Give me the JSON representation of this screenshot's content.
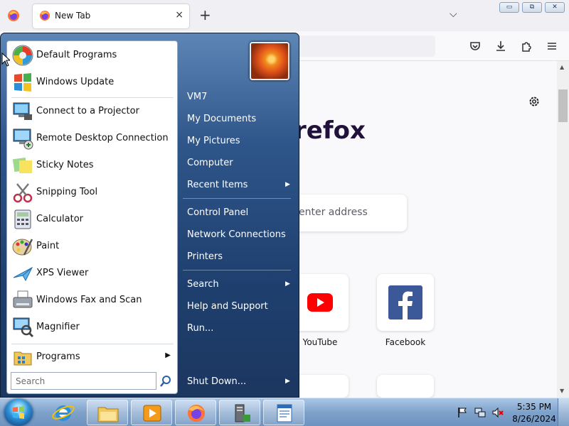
{
  "browser": {
    "tab_title": "New Tab",
    "tab_close": "×",
    "new_tab": "+",
    "list_tabs": "⌵",
    "window_buttons": [
      "▭",
      "⧉",
      "✕"
    ],
    "content": {
      "brand_text": "refox",
      "search_placeholder": "enter address",
      "shortcuts": [
        {
          "label": "YouTube"
        },
        {
          "label": "Facebook"
        }
      ]
    },
    "toolbar_icons": [
      "pocket-icon",
      "download-icon",
      "extensions-icon",
      "menu-icon"
    ],
    "accent": "#ff7139"
  },
  "start_menu": {
    "programs": [
      {
        "label": "Default Programs",
        "icon": "default-programs-icon"
      },
      {
        "label": "Windows Update",
        "icon": "windows-update-icon"
      },
      {
        "label": "Connect to a Projector",
        "icon": "projector-icon"
      },
      {
        "label": "Remote Desktop Connection",
        "icon": "remote-desktop-icon"
      },
      {
        "label": "Sticky Notes",
        "icon": "sticky-notes-icon"
      },
      {
        "label": "Snipping Tool",
        "icon": "snipping-tool-icon"
      },
      {
        "label": "Calculator",
        "icon": "calculator-icon"
      },
      {
        "label": "Paint",
        "icon": "paint-icon"
      },
      {
        "label": "XPS Viewer",
        "icon": "xps-viewer-icon"
      },
      {
        "label": "Windows Fax and Scan",
        "icon": "fax-scan-icon"
      },
      {
        "label": "Magnifier",
        "icon": "magnifier-icon"
      }
    ],
    "all_programs": "Programs",
    "search_placeholder": "Search",
    "right_links": [
      {
        "label": "VM7",
        "arrow": false
      },
      {
        "label": "My Documents",
        "arrow": false
      },
      {
        "label": "My Pictures",
        "arrow": false
      },
      {
        "label": "Computer",
        "arrow": false
      },
      {
        "label": "Recent Items",
        "arrow": true
      },
      {
        "label": "Control Panel",
        "arrow": false
      },
      {
        "label": "Network Connections",
        "arrow": false
      },
      {
        "label": "Printers",
        "arrow": false
      },
      {
        "label": "Search",
        "arrow": true
      },
      {
        "label": "Help and Support",
        "arrow": false
      },
      {
        "label": "Run...",
        "arrow": false
      }
    ],
    "shut_down": "Shut Down...",
    "arrow_glyph": "▶"
  },
  "taskbar": {
    "clock_time": "5:35 PM",
    "clock_date": "8/26/2024",
    "tray_icons": [
      "action-center-flag-icon",
      "network-icon",
      "volume-muted-icon"
    ],
    "pinned": [
      "internet-explorer-icon",
      "file-explorer-icon",
      "media-player-icon",
      "firefox-icon",
      "server-manager-icon",
      "wordpad-icon"
    ]
  }
}
